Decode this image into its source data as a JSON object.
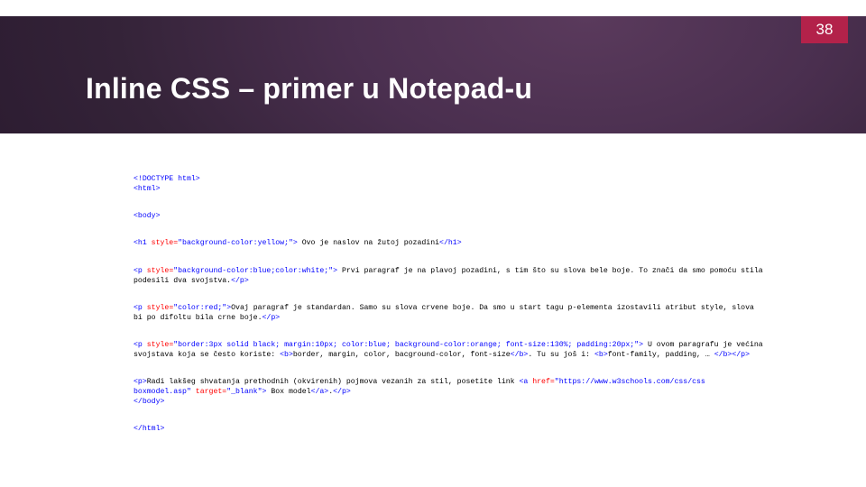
{
  "page_number": "38",
  "title": "Inline CSS – primer u Notepad-u",
  "code": {
    "l1": "<!DOCTYPE html>",
    "l2": "<html>",
    "l3": "<body>",
    "h1_open": "<h1 ",
    "h1_style_attr": "style=",
    "h1_style_val": "\"background-color:yellow;\"",
    "h1_close_open": ">",
    "h1_text": " Ovo je naslov na žutoj pozadini",
    "h1_close": "</h1>",
    "p1_open": "<p ",
    "p1_style_attr": "style=",
    "p1_style_val": "\"background-color:blue;color:white;\"",
    "p1_close_open": ">",
    "p1_text": " Prvi paragraf je na plavoj pozadini, s tim što su slova bele boje. To znači da smo pomoću stila podesili dva svojstva.",
    "p1_close": "</p>",
    "p2_open": "<p ",
    "p2_style_attr": "style=",
    "p2_style_val": "\"color:red;\"",
    "p2_close_open": ">",
    "p2_text": "Ovaj paragraf je standardan. Samo su slova crvene boje. Da smo u start tagu p-elementa izostavili atribut style, slova bi po difoltu bila crne boje.",
    "p2_close": "</p>",
    "p3_open": "<p ",
    "p3_style_attr": "style=",
    "p3_style_val": "\"border:3px solid black; margin:10px; color:blue; background-color:orange; font-size:130%; padding:20px;\"",
    "p3_close_open": ">",
    "p3_text_a": " U ovom paragrafu je većina svojstava koja se često koriste: ",
    "p3_b_open": "<b>",
    "p3_b_text": "border, margin, color, bacground-color, font-size",
    "p3_b_close": "</b>",
    "p3_text_b": ". Tu su još i: ",
    "p3_b2_open": "<b>",
    "p3_b2_text": "font-family, padding, … ",
    "p3_b2_close": "</b>",
    "p3_close": "</p>",
    "p4_open": "<p>",
    "p4_text_a": "Radi lakšeg shvatanja prethodnih (okvirenih) pojmova vezanih za stil, posetite link ",
    "p4_a_open": "<a ",
    "p4_href_attr": "href=",
    "p4_href_val": "\"https://www.w3schools.com/css/css boxmodel.asp\"",
    "p4_target_attr": " target=",
    "p4_target_val": "\"_blank\"",
    "p4_a_close_open": ">",
    "p4_a_text": " Box model",
    "p4_a_close": "</a>",
    "p4_text_b": ".",
    "p4_close": "</p>",
    "body_close": "</body>",
    "html_close": "</html>"
  }
}
